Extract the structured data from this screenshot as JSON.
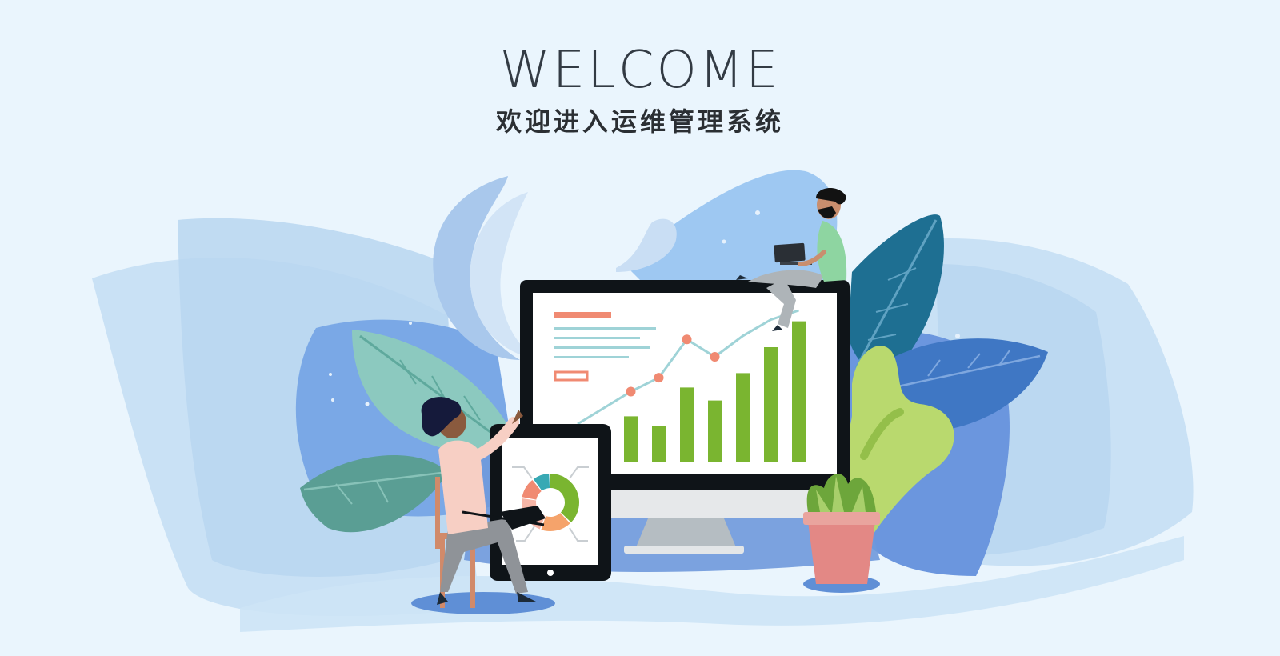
{
  "header": {
    "title": "WELCOME",
    "subtitle": "欢迎进入运维管理系统"
  },
  "colors": {
    "background": "#eaf5fd",
    "title_text": "#333b44",
    "accent_green": "#7ab530",
    "accent_coral": "#f08a72",
    "accent_teal": "#9fd3d7",
    "monitor_frame": "#0f1418"
  },
  "illustration": {
    "dashboard_bars": [
      0.32,
      0.25,
      0.52,
      0.43,
      0.62,
      0.8,
      0.98
    ],
    "dashboard_line": [
      0.3,
      0.42,
      0.75,
      0.6,
      0.78,
      0.92,
      1.0
    ],
    "donut_segments": [
      {
        "value": 38,
        "color": "#7ab530"
      },
      {
        "value": 18,
        "color": "#f5a36b"
      },
      {
        "value": 22,
        "color": "#f6b6a7"
      },
      {
        "value": 12,
        "color": "#f08a72"
      },
      {
        "value": 10,
        "color": "#38a9b4"
      }
    ]
  }
}
